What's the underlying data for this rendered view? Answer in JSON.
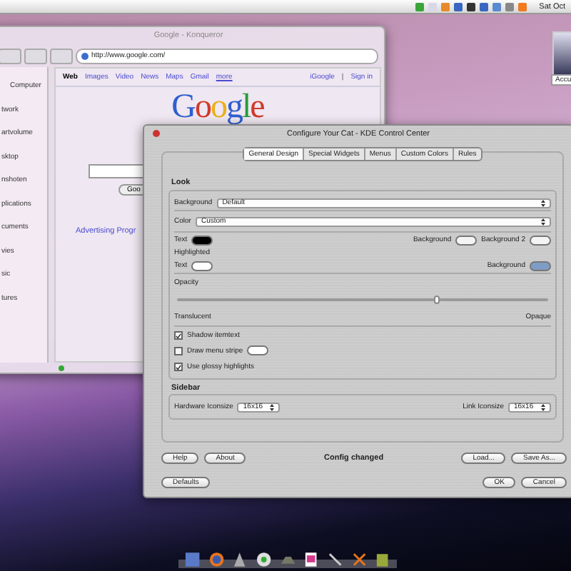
{
  "menubar": {
    "clock": "Sat Oct"
  },
  "browser": {
    "title": "Google - Konqueror",
    "url": "http://www.google.com/",
    "sidebar": [
      "Computer",
      "twork",
      "artvolume",
      "sktop",
      "nshoten",
      "plications",
      "cuments",
      "vies",
      "sic",
      "tures"
    ],
    "nav_links": [
      {
        "label": "Web",
        "selected": true
      },
      {
        "label": "Images",
        "selected": false
      },
      {
        "label": "Video",
        "selected": false
      },
      {
        "label": "News",
        "selected": false
      },
      {
        "label": "Maps",
        "selected": false
      },
      {
        "label": "Gmail",
        "selected": false
      },
      {
        "label": "more",
        "selected": false
      }
    ],
    "account_links": [
      "iGoogle",
      "Sign in"
    ],
    "separator": "|",
    "logo": "Google",
    "search_button": "Goo",
    "advertising": "Advertising Progr"
  },
  "side_window": {
    "label": "Accu"
  },
  "dialog": {
    "title": "Configure Your Cat - KDE Control Center",
    "tabs": [
      {
        "label": "General Design",
        "selected": true
      },
      {
        "label": "Special Widgets",
        "selected": false
      },
      {
        "label": "Menus",
        "selected": false
      },
      {
        "label": "Custom Colors",
        "selected": false
      },
      {
        "label": "Rules",
        "selected": false
      }
    ],
    "look": {
      "heading": "Look",
      "background_label": "Background",
      "background_value": "Default",
      "color_label": "Color",
      "color_value": "Custom",
      "colors": [
        {
          "label": "Text",
          "color": "#000000"
        },
        {
          "label": "Background",
          "color": "#f4f4f4"
        },
        {
          "label": "Background 2",
          "color": "#f4f4f4"
        }
      ],
      "highlighted_label": "Highlighted",
      "highlight_colors": [
        {
          "label": "Text",
          "color": "#ffffff"
        },
        {
          "label": "Background",
          "color": "#7f9cc4"
        }
      ],
      "opacity_label": "Opacity",
      "opacity": {
        "level": 0.7
      },
      "min_label": "Translucent",
      "max_label": "Opaque",
      "options": [
        {
          "label": "Shadow itemtext",
          "checked": true
        },
        {
          "label": "Draw menu stripe",
          "checked": false,
          "color": "#ffffff"
        },
        {
          "label": "Use glossy highlights",
          "checked": true
        }
      ]
    },
    "sidebar": {
      "heading": "Sidebar",
      "hardware_label": "Hardware Iconsize",
      "hardware_value": "16x16",
      "link_label": "Link Iconsize",
      "link_value": "16x16"
    },
    "status": "Config changed",
    "buttons_row1_left": [
      "Help",
      "About"
    ],
    "buttons_row1_right": [
      "Load...",
      "Save As..."
    ],
    "buttons_row2_left": [
      "Defaults"
    ],
    "buttons_row2_right": [
      "OK",
      "Cancel"
    ]
  }
}
